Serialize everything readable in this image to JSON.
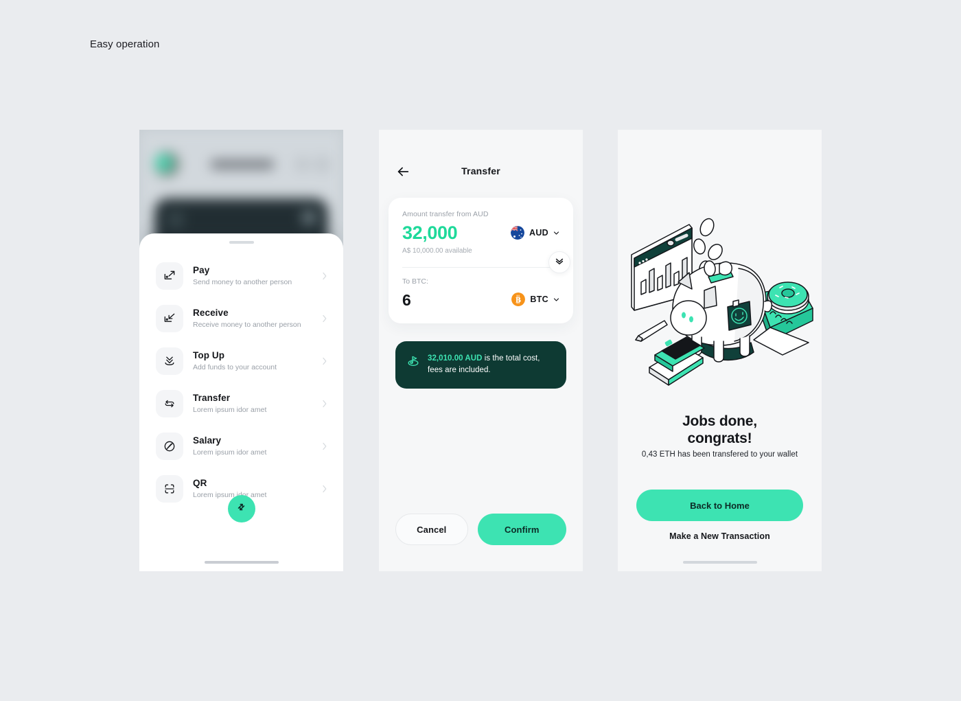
{
  "page": {
    "label": "Easy operation",
    "background": "#EAECEF",
    "accent": "#3DE3B2",
    "accent_text": "#1ED99A",
    "dark": "#0E3A33"
  },
  "screen_home": {
    "operations": [
      {
        "icon": "pay-icon",
        "title": "Pay",
        "subtitle": "Send money to another person"
      },
      {
        "icon": "receive-icon",
        "title": "Receive",
        "subtitle": "Receive money to another person"
      },
      {
        "icon": "topup-icon",
        "title": "Top Up",
        "subtitle": "Add funds to your account"
      },
      {
        "icon": "transfer-icon",
        "title": "Transfer",
        "subtitle": "Lorem ipsum idor amet"
      },
      {
        "icon": "salary-icon",
        "title": "Salary",
        "subtitle": "Lorem ipsum idor amet"
      },
      {
        "icon": "qr-icon",
        "title": "QR",
        "subtitle": "Lorem ipsum idor amet"
      }
    ],
    "fab_icon": "transfer-arrows-icon"
  },
  "screen_transfer": {
    "back_icon": "arrow-left-icon",
    "title": "Transfer",
    "from": {
      "label": "Amount transfer from AUD",
      "amount": "32,000",
      "available": "A$ 10,000.00 available",
      "currency_code": "AUD",
      "currency_icon": "aud-flag-icon"
    },
    "swap_icon": "double-chevron-down-icon",
    "to": {
      "label": "To BTC:",
      "amount": "6",
      "currency_code": "BTC",
      "currency_icon": "bitcoin-icon"
    },
    "notice": {
      "icon": "flag-green-icon",
      "highlight": "32,010.00 AUD",
      "rest": " is the total cost, fees are included."
    },
    "cancel_label": "Cancel",
    "confirm_label": "Confirm"
  },
  "screen_success": {
    "illustration": "piggy-bank-illustration",
    "title_line1": "Jobs done,",
    "title_line2": "congrats!",
    "subtitle": "0,43 ETH has been transfered to your wallet",
    "primary_label": "Back to Home",
    "secondary_label": "Make a New Transaction"
  }
}
